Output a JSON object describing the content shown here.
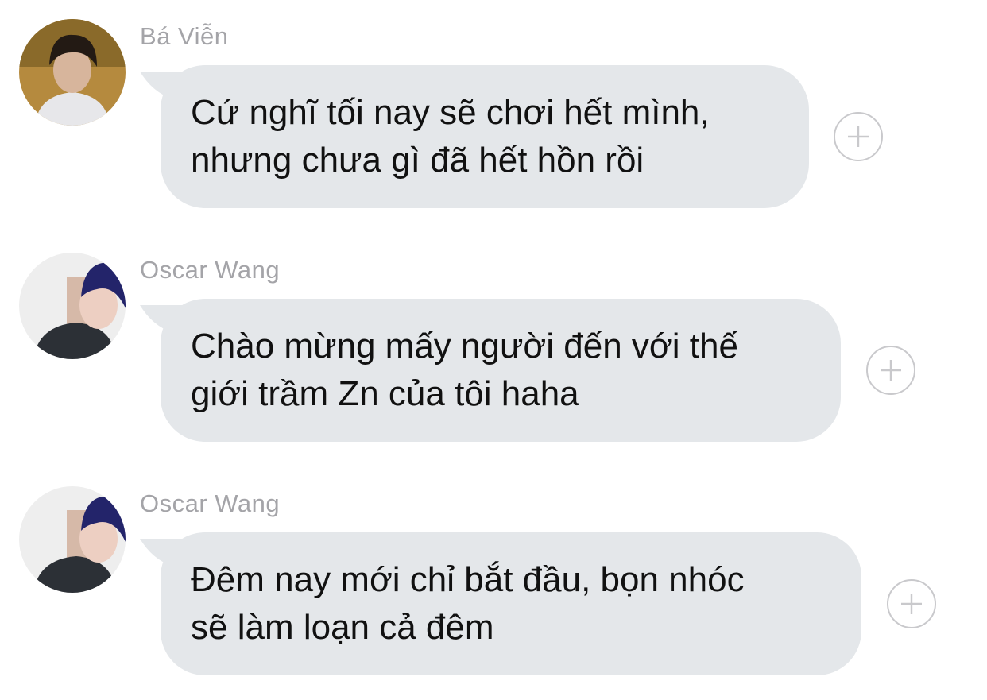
{
  "messages": [
    {
      "sender": "Bá Viễn",
      "avatar": "avatar-photo",
      "lines": [
        "Cứ nghĩ tối nay sẽ chơi hết mình,",
        "nhưng chưa gì đã hết hồn rồi"
      ]
    },
    {
      "sender": "Oscar Wang",
      "avatar": "avatar-photo",
      "lines": [
        "Chào mừng mấy người đến với thế",
        "giới trầm Zn của tôi haha"
      ]
    },
    {
      "sender": "Oscar Wang",
      "avatar": "avatar-photo",
      "lines": [
        "Đêm nay mới chỉ bắt đầu, bọn nhóc",
        "sẽ làm loạn cả đêm"
      ]
    }
  ],
  "react_button_icon": "plus-circle-icon",
  "colors": {
    "bubble": "#e4e7ea",
    "sender_name": "#a4a4a8",
    "message_text": "#111111",
    "react_button_border": "#c9c9cc"
  }
}
